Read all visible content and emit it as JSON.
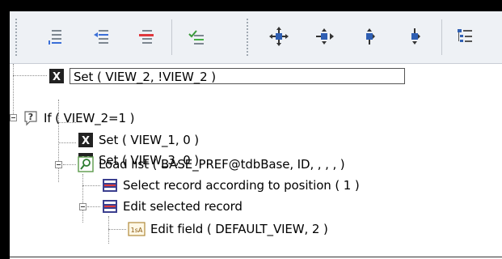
{
  "toolbar": {
    "buttons": [
      {
        "name": "indent-lines-icon"
      },
      {
        "name": "insert-line-left-icon"
      },
      {
        "name": "remove-line-icon"
      },
      {
        "name": "check-lines-icon"
      },
      {
        "name": "move-node-icon"
      },
      {
        "name": "move-node-right-icon"
      },
      {
        "name": "move-node-down-icon"
      },
      {
        "name": "move-node-up-icon"
      },
      {
        "name": "tree-view-icon"
      }
    ]
  },
  "tree": {
    "nodes": [
      {
        "label": "Set ( VIEW_2, !VIEW_2 )",
        "icon": "set-icon",
        "selected": true
      },
      {
        "label": "If ( VIEW_2=1 )",
        "icon": "question-icon"
      },
      {
        "label": "Set ( VIEW_1, 0 )",
        "icon": "set-icon"
      },
      {
        "label": "Set ( VIEW_3, 0 )",
        "icon": "set-icon"
      },
      {
        "label": "Load list ( BASE_PREF@tdbBase, ID, , , ,  )",
        "icon": "search-list-icon"
      },
      {
        "label": "Select record according to position ( 1 )",
        "icon": "record-icon"
      },
      {
        "label": "Edit selected record",
        "icon": "record-icon"
      },
      {
        "label": "Edit field ( DEFAULT_VIEW, 2 )",
        "icon": "edit-field-icon",
        "icon_text": "1sA"
      }
    ]
  }
}
